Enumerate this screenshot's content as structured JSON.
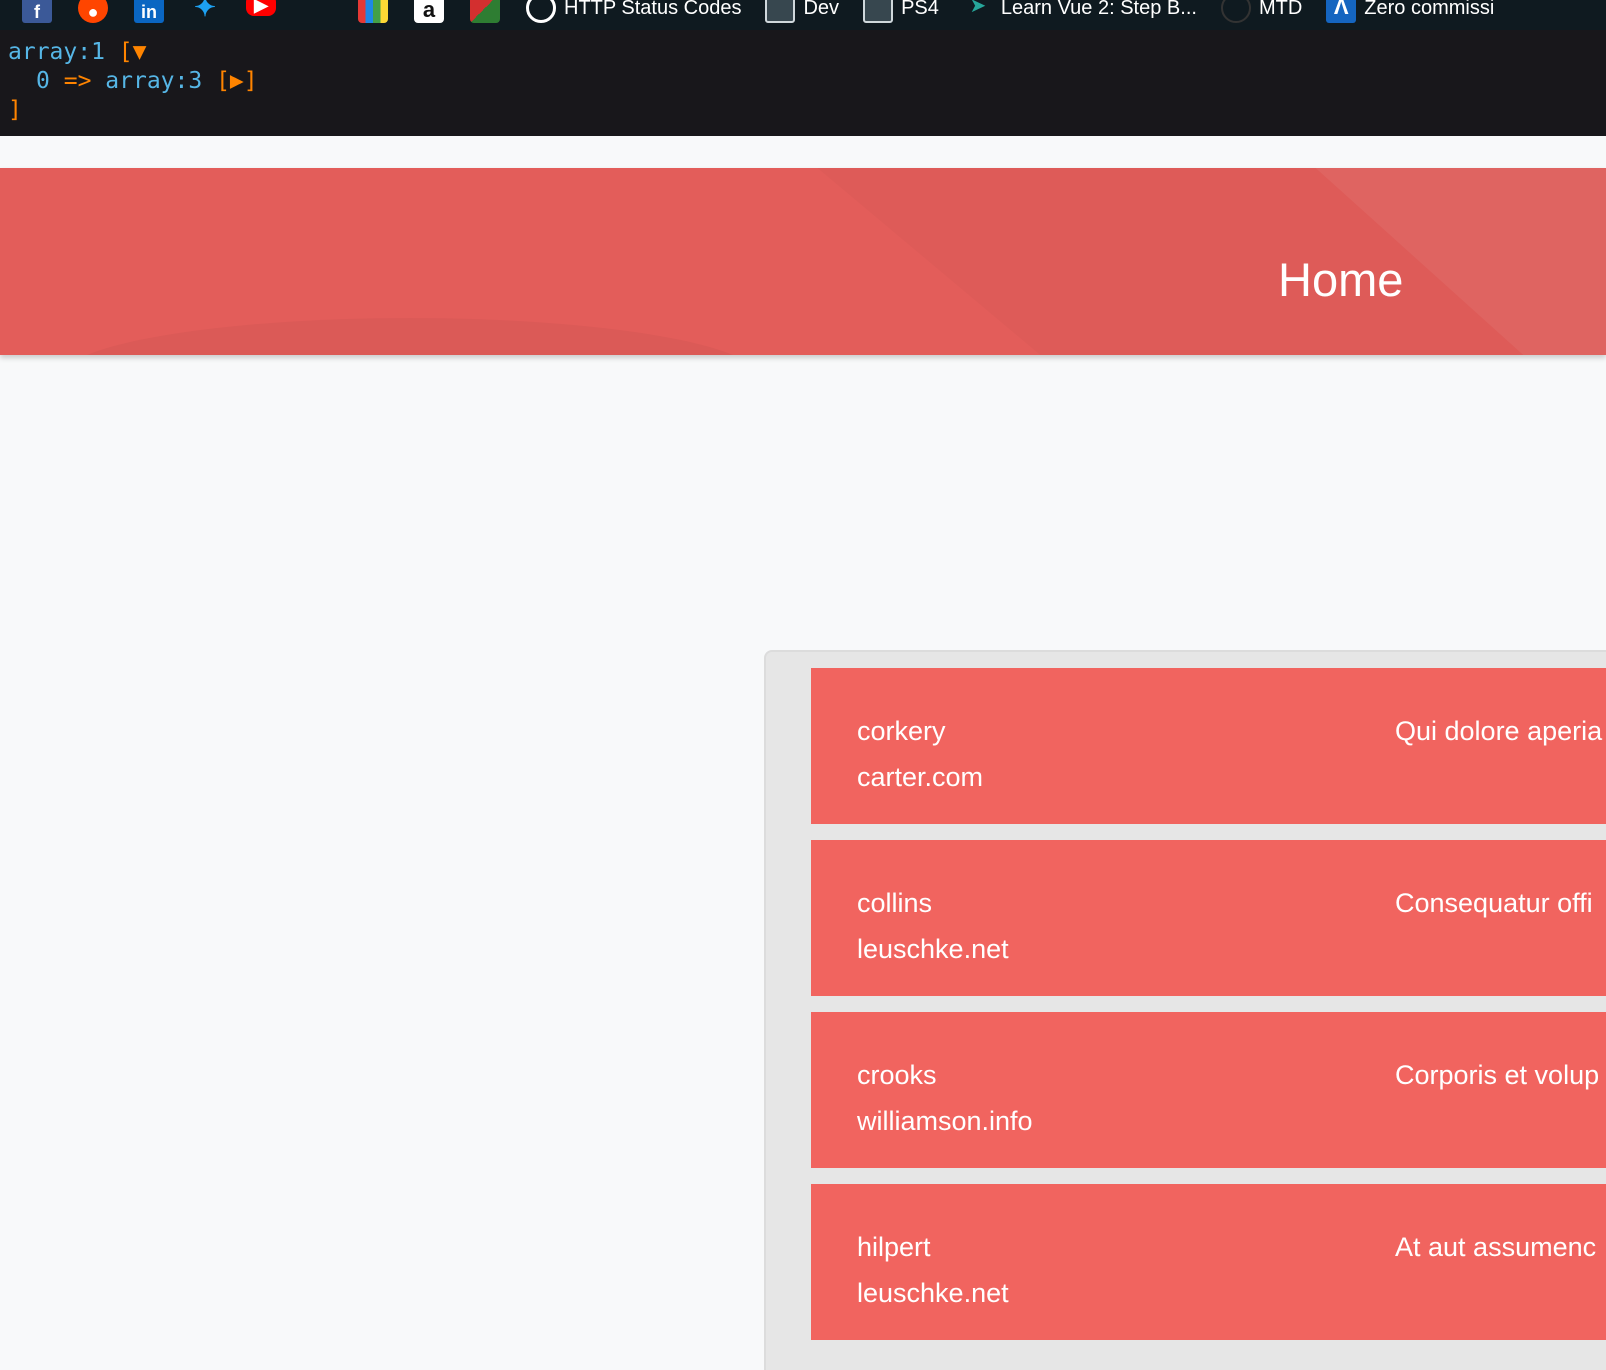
{
  "bookmarks": {
    "icons": [
      "facebook-icon",
      "reddit-icon",
      "linkedin-icon",
      "twitter-icon",
      "youtube-icon",
      "microsoft-icon",
      "bar-icon",
      "amazon-icon",
      "pdf-icon"
    ],
    "links": [
      {
        "label": "HTTP Status Codes",
        "icon": "globe-icon"
      },
      {
        "label": "Dev",
        "icon": "folder-icon"
      },
      {
        "label": "PS4",
        "icon": "folder-icon"
      },
      {
        "label": "Learn Vue 2: Step B...",
        "icon": "arrow-icon"
      },
      {
        "label": "MTD",
        "icon": "mtd-icon"
      },
      {
        "label": "Zero commissi",
        "icon": "zero-icon"
      }
    ]
  },
  "dump": {
    "line1_type": "array:1",
    "line1_toggle": "[▼",
    "line2_key": "0",
    "line2_arrow": "=>",
    "line2_type": "array:3",
    "line2_toggle": "[▶]",
    "line3_close": "]"
  },
  "header": {
    "title": "Home",
    "color": "#e35d5a"
  },
  "rows": [
    {
      "name": "corkery",
      "domain": "carter.com",
      "desc": "Qui dolore aperia"
    },
    {
      "name": "collins",
      "domain": "leuschke.net",
      "desc": "Consequatur offi"
    },
    {
      "name": "crooks",
      "domain": "williamson.info",
      "desc": "Corporis et volup"
    },
    {
      "name": "hilpert",
      "domain": "leuschke.net",
      "desc": "At aut assumenc"
    }
  ],
  "row_color": "#f1645f"
}
